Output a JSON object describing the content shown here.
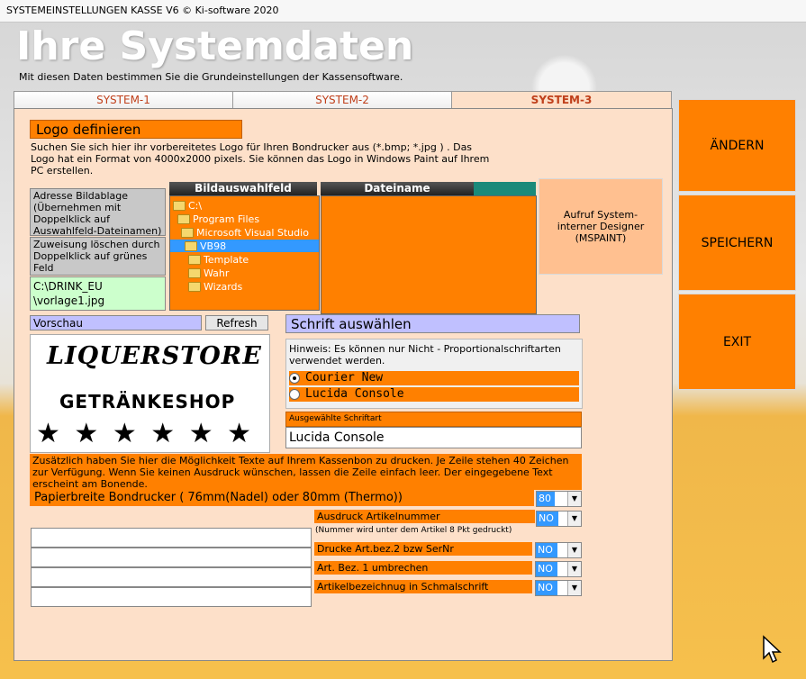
{
  "window": {
    "title": "SYSTEMEINSTELLUNGEN KASSE  V6  © Ki-software 2020"
  },
  "header": {
    "title": "Ihre Systemdaten",
    "subtitle": "Mit diesen Daten bestimmen Sie die Grundeinstellungen der Kassensoftware."
  },
  "tabs": [
    {
      "label": "SYSTEM-1"
    },
    {
      "label": "SYSTEM-2"
    },
    {
      "label": "SYSTEM-3"
    }
  ],
  "logo": {
    "heading": "Logo definieren",
    "description": "Suchen Sie sich hier ihr vorbereitetes Logo für Ihren Bondrucker aus (*.bmp; *.jpg ) . Das Logo hat ein Format von 4000x2000 pixels. Sie können das Logo in Windows Paint auf Ihrem PC erstellen.",
    "address_label": "Adresse Bildablage (Übernehmen mit Doppelklick auf Auswahlfeld-Dateinamen)",
    "clear_label": "Zuweisung löschen durch Doppelklick auf grünes Feld",
    "path_line1": "C:\\DRINK_EU",
    "path_line2": "\\vorlage1.jpg",
    "picker_header": "Bildauswahlfeld",
    "filename_header": "Dateiname",
    "tree": [
      {
        "label": "C:\\"
      },
      {
        "label": "Program Files"
      },
      {
        "label": "Microsoft Visual Studio"
      },
      {
        "label": "VB98"
      },
      {
        "label": "Template"
      },
      {
        "label": "Wahr"
      },
      {
        "label": "Wizards"
      }
    ],
    "designer_button": "Aufruf  System-interner Designer (MSPAINT)"
  },
  "preview": {
    "label": "Vorschau",
    "refresh": "Refresh",
    "logo_line1": "LIQUERSTORE",
    "logo_line2": "GETRÄNKESHOP",
    "stars": "★ ★ ★ ★ ★ ★"
  },
  "font": {
    "heading": "Schrift auswählen",
    "hint": "Hinweis: Es können nur Nicht - Proportionalschriftarten verwendet werden.",
    "options": [
      {
        "label": "Courier New",
        "selected": true
      },
      {
        "label": "Lucida Console",
        "selected": false
      }
    ],
    "selected_label": "Ausgewählte Schriftart",
    "selected_value": "Lucida Console"
  },
  "receipt": {
    "info": "Zusätzlich haben Sie hier die Möglichkeit Texte auf Ihrem Kassenbon zu drucken. Je Zeile stehen 40 Zeichen zur Verfügung. Wenn Sie keinen Ausdruck wünschen, lassen die Zeile einfach leer. Der eingegebene Text erscheint am Bonende.",
    "paper_label": "Papierbreite Bondrucker ( 76mm(Nadel) oder 80mm (Thermo))",
    "paper_value": "80",
    "lines": [
      "",
      "",
      "",
      ""
    ]
  },
  "options": {
    "article_number_label": "Ausdruck Artikelnummer",
    "article_number_value": "NO",
    "article_number_note": "(Nummer wird unter dem Artikel 8 Pkt gedruckt)",
    "serial_label": "Drucke Art.bez.2 bzw SerNr",
    "serial_value": "NO",
    "wrap_label": "Art. Bez. 1 umbrechen",
    "wrap_value": "NO",
    "narrow_label": "Artikelbezeichnug in Schmalschrift",
    "narrow_value": "NO"
  },
  "side_buttons": {
    "change": "ÄNDERN",
    "save": "SPEICHERN",
    "exit": "EXIT"
  },
  "colors": {
    "accent": "#ff8000",
    "panel": "#fde0c9",
    "tab_text": "#c0401b",
    "path_field": "#ccffcc",
    "lavender": "#c0c0ff"
  }
}
